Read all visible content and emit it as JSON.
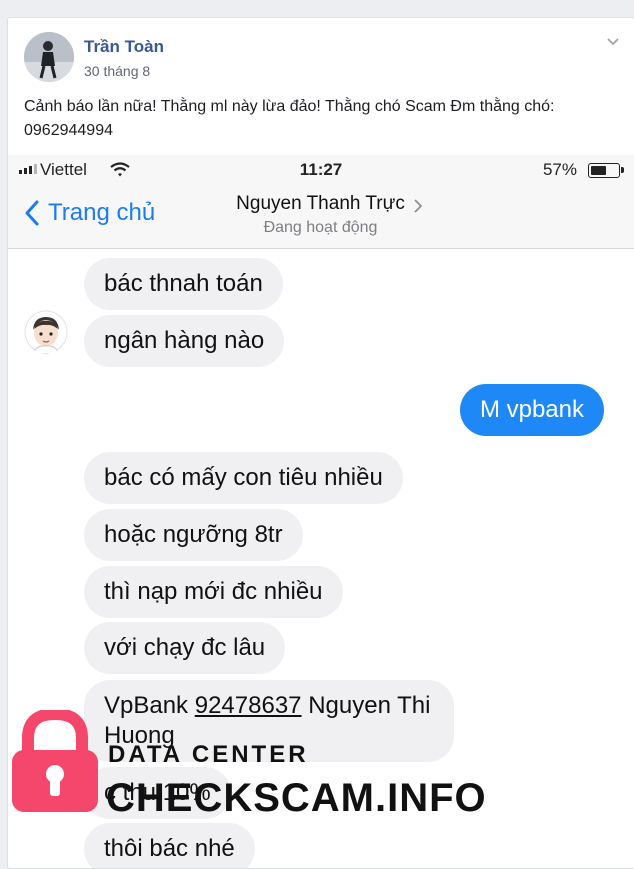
{
  "post": {
    "author": "Trần Toàn",
    "date": "30 tháng 8",
    "text": "Cảnh báo lần nữa! Thằng ml này lừa đảo! Thằng chó Scam Đm thằng chó: 0962944994"
  },
  "status_bar": {
    "carrier": "Viettel",
    "time": "11:27",
    "battery": "57%",
    "battery_level": 0.57
  },
  "chat_header": {
    "back_label": "Trang chủ",
    "contact_name": "Nguyen Thanh Trực",
    "contact_status": "Đang hoạt động"
  },
  "messages": {
    "m1": "bác thnah toán",
    "m2": "ngân hàng nào",
    "m3": "M vpbank",
    "m4": "bác có mấy con tiêu nhiều",
    "m5": "hoặc ngưỡng 8tr",
    "m6": "thì nạp mới đc nhiều",
    "m7": "với chạy đc lâu",
    "m8_prefix": "VpBank",
    "m8_account": "92478637",
    "m8_suffix": "Nguyen Thi Huong",
    "m9": "c thu 10%",
    "m10": "thôi bác nhé"
  },
  "watermark": {
    "small": "DATA CENTER",
    "big": "CHECKSCAM.INFO"
  },
  "colors": {
    "author_link": "#385898",
    "ios_blue": "#1a7cf3",
    "outgoing_bubble": "#1d88f6",
    "incoming_bubble": "#f0f0f3",
    "lock_red": "#f5476b"
  },
  "icons": [
    "user-avatar",
    "chevron-down-icon",
    "signal-icon",
    "wifi-icon",
    "battery-icon",
    "back-chevron-icon",
    "chevron-right-icon",
    "contact-avatar",
    "lock-icon"
  ]
}
